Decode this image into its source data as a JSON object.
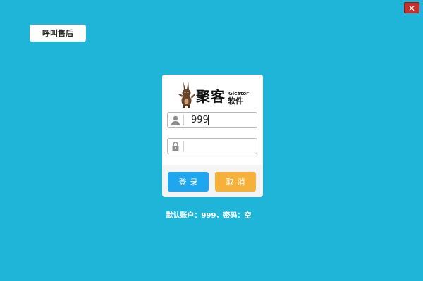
{
  "window": {
    "close_label": "✕"
  },
  "hotline_button": {
    "label": "呼叫售后"
  },
  "login_card": {
    "logo": {
      "brand_cn": "聚客",
      "brand_en": "Gicator",
      "brand_sub_cn": "软件",
      "mascot_icon": "rabbit-mascot-icon"
    },
    "username": {
      "value": "999",
      "icon": "user-icon"
    },
    "password": {
      "value": "",
      "icon": "lock-icon"
    },
    "login_button": {
      "label": "登录"
    },
    "cancel_button": {
      "label": "取消"
    }
  },
  "hint_text": "默认账户：999，密码：空",
  "colors": {
    "background": "#1fb5d9",
    "login_button": "#1ea6ee",
    "cancel_button": "#f5b13a",
    "close_button": "#c9302c"
  }
}
